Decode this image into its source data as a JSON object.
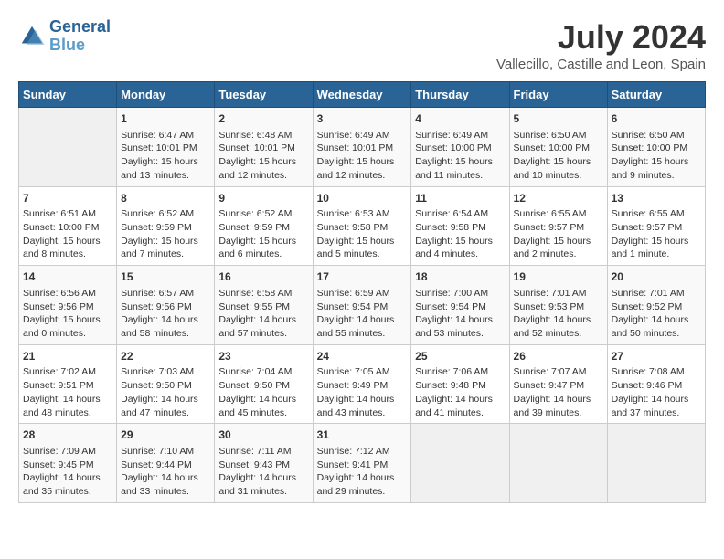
{
  "header": {
    "logo_line1": "General",
    "logo_line2": "Blue",
    "month_year": "July 2024",
    "location": "Vallecillo, Castille and Leon, Spain"
  },
  "days_of_week": [
    "Sunday",
    "Monday",
    "Tuesday",
    "Wednesday",
    "Thursday",
    "Friday",
    "Saturday"
  ],
  "weeks": [
    [
      {
        "day": "",
        "content": ""
      },
      {
        "day": "1",
        "content": "Sunrise: 6:47 AM\nSunset: 10:01 PM\nDaylight: 15 hours\nand 13 minutes."
      },
      {
        "day": "2",
        "content": "Sunrise: 6:48 AM\nSunset: 10:01 PM\nDaylight: 15 hours\nand 12 minutes."
      },
      {
        "day": "3",
        "content": "Sunrise: 6:49 AM\nSunset: 10:01 PM\nDaylight: 15 hours\nand 12 minutes."
      },
      {
        "day": "4",
        "content": "Sunrise: 6:49 AM\nSunset: 10:00 PM\nDaylight: 15 hours\nand 11 minutes."
      },
      {
        "day": "5",
        "content": "Sunrise: 6:50 AM\nSunset: 10:00 PM\nDaylight: 15 hours\nand 10 minutes."
      },
      {
        "day": "6",
        "content": "Sunrise: 6:50 AM\nSunset: 10:00 PM\nDaylight: 15 hours\nand 9 minutes."
      }
    ],
    [
      {
        "day": "7",
        "content": "Sunrise: 6:51 AM\nSunset: 10:00 PM\nDaylight: 15 hours\nand 8 minutes."
      },
      {
        "day": "8",
        "content": "Sunrise: 6:52 AM\nSunset: 9:59 PM\nDaylight: 15 hours\nand 7 minutes."
      },
      {
        "day": "9",
        "content": "Sunrise: 6:52 AM\nSunset: 9:59 PM\nDaylight: 15 hours\nand 6 minutes."
      },
      {
        "day": "10",
        "content": "Sunrise: 6:53 AM\nSunset: 9:58 PM\nDaylight: 15 hours\nand 5 minutes."
      },
      {
        "day": "11",
        "content": "Sunrise: 6:54 AM\nSunset: 9:58 PM\nDaylight: 15 hours\nand 4 minutes."
      },
      {
        "day": "12",
        "content": "Sunrise: 6:55 AM\nSunset: 9:57 PM\nDaylight: 15 hours\nand 2 minutes."
      },
      {
        "day": "13",
        "content": "Sunrise: 6:55 AM\nSunset: 9:57 PM\nDaylight: 15 hours\nand 1 minute."
      }
    ],
    [
      {
        "day": "14",
        "content": "Sunrise: 6:56 AM\nSunset: 9:56 PM\nDaylight: 15 hours\nand 0 minutes."
      },
      {
        "day": "15",
        "content": "Sunrise: 6:57 AM\nSunset: 9:56 PM\nDaylight: 14 hours\nand 58 minutes."
      },
      {
        "day": "16",
        "content": "Sunrise: 6:58 AM\nSunset: 9:55 PM\nDaylight: 14 hours\nand 57 minutes."
      },
      {
        "day": "17",
        "content": "Sunrise: 6:59 AM\nSunset: 9:54 PM\nDaylight: 14 hours\nand 55 minutes."
      },
      {
        "day": "18",
        "content": "Sunrise: 7:00 AM\nSunset: 9:54 PM\nDaylight: 14 hours\nand 53 minutes."
      },
      {
        "day": "19",
        "content": "Sunrise: 7:01 AM\nSunset: 9:53 PM\nDaylight: 14 hours\nand 52 minutes."
      },
      {
        "day": "20",
        "content": "Sunrise: 7:01 AM\nSunset: 9:52 PM\nDaylight: 14 hours\nand 50 minutes."
      }
    ],
    [
      {
        "day": "21",
        "content": "Sunrise: 7:02 AM\nSunset: 9:51 PM\nDaylight: 14 hours\nand 48 minutes."
      },
      {
        "day": "22",
        "content": "Sunrise: 7:03 AM\nSunset: 9:50 PM\nDaylight: 14 hours\nand 47 minutes."
      },
      {
        "day": "23",
        "content": "Sunrise: 7:04 AM\nSunset: 9:50 PM\nDaylight: 14 hours\nand 45 minutes."
      },
      {
        "day": "24",
        "content": "Sunrise: 7:05 AM\nSunset: 9:49 PM\nDaylight: 14 hours\nand 43 minutes."
      },
      {
        "day": "25",
        "content": "Sunrise: 7:06 AM\nSunset: 9:48 PM\nDaylight: 14 hours\nand 41 minutes."
      },
      {
        "day": "26",
        "content": "Sunrise: 7:07 AM\nSunset: 9:47 PM\nDaylight: 14 hours\nand 39 minutes."
      },
      {
        "day": "27",
        "content": "Sunrise: 7:08 AM\nSunset: 9:46 PM\nDaylight: 14 hours\nand 37 minutes."
      }
    ],
    [
      {
        "day": "28",
        "content": "Sunrise: 7:09 AM\nSunset: 9:45 PM\nDaylight: 14 hours\nand 35 minutes."
      },
      {
        "day": "29",
        "content": "Sunrise: 7:10 AM\nSunset: 9:44 PM\nDaylight: 14 hours\nand 33 minutes."
      },
      {
        "day": "30",
        "content": "Sunrise: 7:11 AM\nSunset: 9:43 PM\nDaylight: 14 hours\nand 31 minutes."
      },
      {
        "day": "31",
        "content": "Sunrise: 7:12 AM\nSunset: 9:41 PM\nDaylight: 14 hours\nand 29 minutes."
      },
      {
        "day": "",
        "content": ""
      },
      {
        "day": "",
        "content": ""
      },
      {
        "day": "",
        "content": ""
      }
    ]
  ]
}
